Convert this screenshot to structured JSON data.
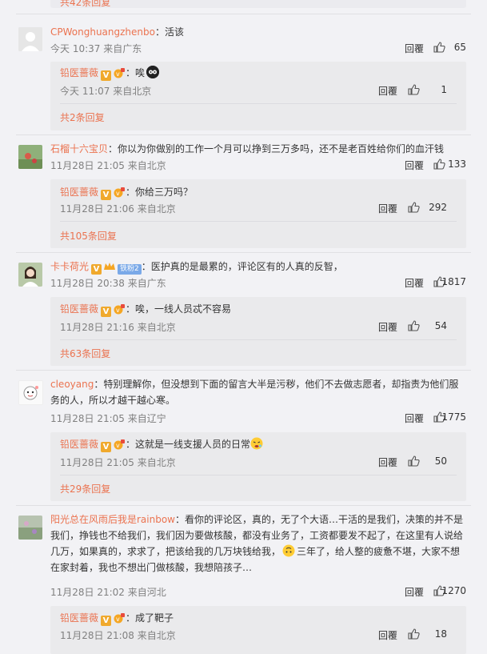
{
  "top_more": "共42条回复",
  "reply_label": "回覆",
  "comments": [
    {
      "user": "CPWonghuangzhenbo",
      "text": "：活该",
      "time": "今天 10:37 来自广东",
      "likes": "65",
      "sub": {
        "user": "铅医蔷薇",
        "text": "：唉",
        "time": "今天 11:07 来自北京",
        "likes": "1"
      },
      "more": "共2条回复"
    },
    {
      "user": "石榴十六宝贝",
      "text": "：你以为你做别的工作一个月可以挣到三万多吗，还不是老百姓给你们的血汗钱",
      "time": "11月28日 21:05 来自北京",
      "likes": "133",
      "sub": {
        "user": "铅医蔷薇",
        "text": "：你给三万吗？",
        "time": "11月28日 21:06 来自北京",
        "likes": "292"
      },
      "more": "共105条回复"
    },
    {
      "user": "卡卡荷光",
      "level": "铁粉2",
      "text": "：医护真的是最累的，评论区有的人真的反智，",
      "time": "11月28日 20:38 来自广东",
      "likes": "1817",
      "sub": {
        "user": "铅医蔷薇",
        "text": "：唉，一线人员忒不容易",
        "time": "11月28日 21:16 来自北京",
        "likes": "54"
      },
      "more": "共63条回复"
    },
    {
      "user": "cleoyang",
      "text": "：特别理解你，但没想到下面的留言大半是污秽，他们不去做志愿者，却指责为他们服务的人，所以才越干越心寒。",
      "time": "11月28日 21:05 来自辽宁",
      "likes": "1775",
      "sub": {
        "user": "铅医蔷薇",
        "text": "：这就是一线支援人员的日常",
        "time": "11月28日 21:05 来自北京",
        "likes": "50"
      },
      "more": "共29条回复"
    },
    {
      "user": "阳光总在风雨后我是rainbow",
      "text1": "：看你的评论区，真的，无了个大语…干活的是我们，决策的并不是我们，挣钱也不给我们，我们因为要做核酸，都没有业务了，工资都要发不起了，在这里有人说给几万，如果真的，求求了，把该给我的几万块钱给我，",
      "text2": "三年了，给人整的疲惫不堪，大家不想在家封着，我也不想出门做核酸，我想陪孩子…",
      "time": "11月28日 21:02 来自河北",
      "likes": "1270",
      "sub": {
        "user": "铅医蔷薇",
        "text": "：成了靶子",
        "time": "11月28日 21:08 来自北京",
        "likes": "18"
      }
    }
  ]
}
